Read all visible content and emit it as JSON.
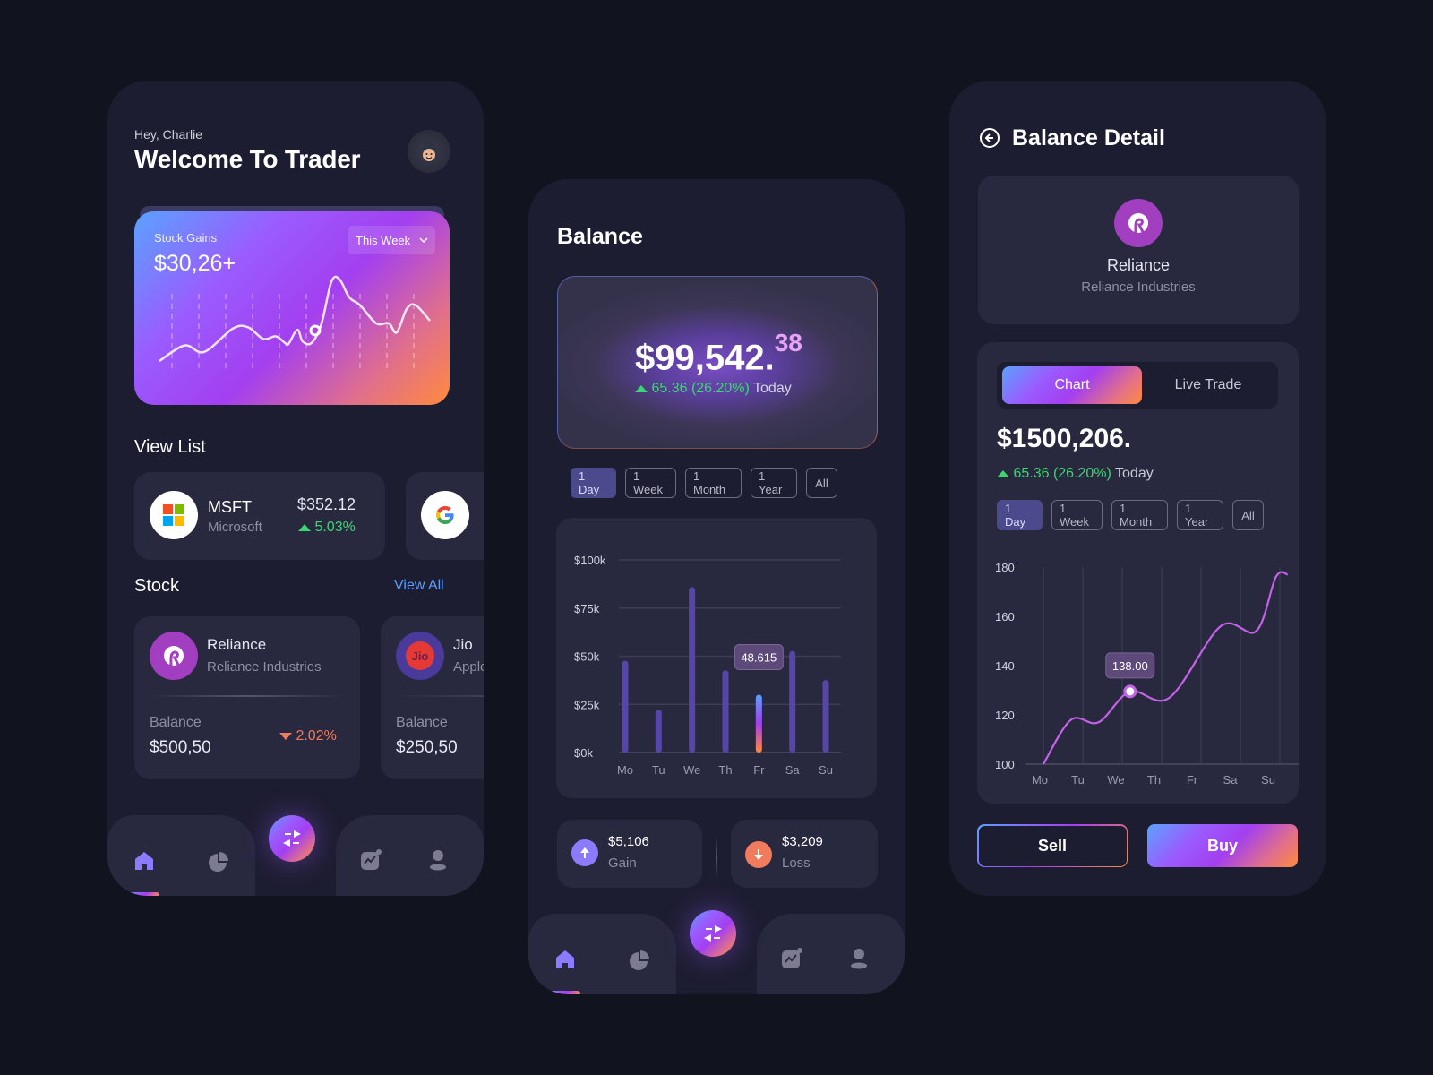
{
  "home": {
    "greeting": "Hey, Charlie",
    "title": "Welcome To Trader",
    "gains_card": {
      "label": "Stock Gains",
      "value": "$30,26+",
      "period_select": "This Week"
    },
    "view_list_title": "View List",
    "watchlist": [
      {
        "ticker": "MSFT",
        "name": "Microsoft",
        "price": "$352.12",
        "change": "5.03%",
        "direction": "up",
        "logo": "microsoft-logo"
      },
      {
        "ticker": "",
        "name": "",
        "logo": "google-logo"
      }
    ],
    "stock_title": "Stock",
    "view_all": "View All",
    "stocks": [
      {
        "name": "Reliance",
        "company": "Reliance Industries",
        "balance_label": "Balance",
        "balance": "$500,50",
        "change": "2.02%",
        "direction": "down",
        "logo_text": ""
      },
      {
        "name": "Jio",
        "company": "Apple",
        "balance_label": "Balance",
        "balance": "$250,50",
        "logo_text": "Jio"
      }
    ]
  },
  "balance": {
    "title": "Balance",
    "amount_main": "$99,542.",
    "amount_cents": "38",
    "change": "65.36 (26.20%)",
    "change_suffix": "Today",
    "ranges": [
      "1 Day",
      "1 Week",
      "1 Month",
      "1 Year",
      "All"
    ],
    "active_range": "1 Day",
    "tooltip": "48.615",
    "gain": {
      "value": "$5,106",
      "label": "Gain"
    },
    "loss": {
      "value": "$3,209",
      "label": "Loss"
    }
  },
  "detail": {
    "title": "Balance Detail",
    "company": "Reliance",
    "company_full": "Reliance Industries",
    "tabs": [
      "Chart",
      "Live Trade"
    ],
    "active_tab": "Chart",
    "price": "$1500,206.",
    "change": "65.36 (26.20%)",
    "change_suffix": "Today",
    "ranges": [
      "1 Day",
      "1 Week",
      "1 Month",
      "1 Year",
      "All"
    ],
    "active_range": "1 Day",
    "tooltip": "138.00",
    "sell": "Sell",
    "buy": "Buy"
  },
  "colors": {
    "accent_purple": "#a33ff0",
    "accent_blue": "#5aa2ff",
    "accent_orange": "#ff8a3d",
    "gain_green": "#3bd671",
    "loss_orange": "#f07c5b",
    "bar": "#5546a8",
    "line": "#c462e8"
  },
  "chart_data": [
    {
      "type": "bar",
      "title": "",
      "categories": [
        "Mo",
        "Tu",
        "We",
        "Th",
        "Fr",
        "Sa",
        "Su"
      ],
      "values": [
        47.7,
        22.3,
        85.9,
        42.7,
        30.0,
        52.7,
        37.6
      ],
      "unit": "k USD",
      "highlighted": "Fr",
      "yticks": [
        "$0k",
        "$25k",
        "$50k",
        "$75k",
        "$100k"
      ],
      "ylim": [
        0,
        100
      ],
      "grid": true,
      "annotation": "48.615"
    },
    {
      "type": "line",
      "title": "",
      "x": [
        "Mo",
        "Tu",
        "We",
        "Th",
        "Fr",
        "Sa",
        "Su"
      ],
      "points": [
        [
          0,
          100
        ],
        [
          0.7,
          118
        ],
        [
          1.4,
          117
        ],
        [
          2.2,
          129.5
        ],
        [
          3.2,
          127
        ],
        [
          4.5,
          156
        ],
        [
          5.4,
          154
        ],
        [
          5.9,
          176
        ],
        [
          6.2,
          177
        ]
      ],
      "highlight_point": [
        2.2,
        129.5
      ],
      "yticks": [
        "100",
        "120",
        "140",
        "160",
        "180"
      ],
      "ylim": [
        100,
        180
      ],
      "grid": true,
      "annotation": "138.00"
    },
    {
      "type": "line",
      "title": "Stock Gains sparkline",
      "values": [
        20,
        32,
        27,
        45,
        46,
        37,
        39,
        34,
        33,
        44,
        35,
        34,
        49,
        81,
        83,
        69,
        63,
        49,
        49,
        42,
        60,
        63,
        51
      ],
      "highlight_index": 12
    }
  ]
}
